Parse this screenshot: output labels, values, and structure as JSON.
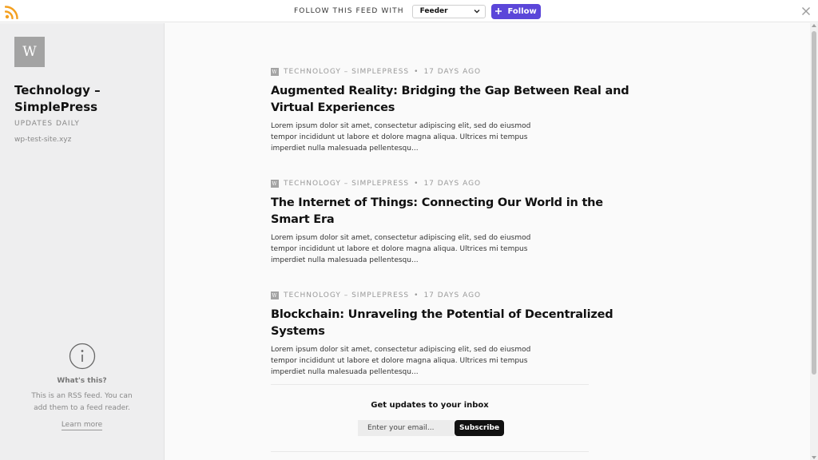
{
  "topbar": {
    "follow_label": "FOLLOW THIS FEED WITH",
    "reader_selected": "Feeder",
    "follow_button": "Follow",
    "accent_color": "#5b46d9",
    "rss_color": "#f4a020"
  },
  "sidebar": {
    "avatar_letter": "W",
    "feed_title": "Technology – SimplePress",
    "frequency": "UPDATES DAILY",
    "site": "wp-test-site.xyz",
    "info": {
      "title": "What's this?",
      "text": "This is an RSS feed. You can add them to a feed reader.",
      "link": "Learn more"
    }
  },
  "articles": [
    {
      "badge": "W",
      "source": "TECHNOLOGY – SIMPLEPRESS",
      "separator": "•",
      "age": "17 DAYS AGO",
      "title": "Augmented Reality: Bridging the Gap Between Real and Virtual Experiences",
      "excerpt": "Lorem ipsum dolor sit amet, consectetur adipiscing elit, sed do eiusmod tempor incididunt ut labore et dolore magna aliqua. Ultrices mi tempus imperdiet nulla malesuada pellentesqu..."
    },
    {
      "badge": "W",
      "source": "TECHNOLOGY – SIMPLEPRESS",
      "separator": "•",
      "age": "17 DAYS AGO",
      "title": "The Internet of Things: Connecting Our World in the Smart Era",
      "excerpt": "Lorem ipsum dolor sit amet, consectetur adipiscing elit, sed do eiusmod tempor incididunt ut labore et dolore magna aliqua. Ultrices mi tempus imperdiet nulla malesuada pellentesqu..."
    },
    {
      "badge": "W",
      "source": "TECHNOLOGY – SIMPLEPRESS",
      "separator": "•",
      "age": "17 DAYS AGO",
      "title": "Blockchain: Unraveling the Potential of Decentralized Systems",
      "excerpt": "Lorem ipsum dolor sit amet, consectetur adipiscing elit, sed do eiusmod tempor incididunt ut labore et dolore magna aliqua. Ultrices mi tempus imperdiet nulla malesuada pellentesqu..."
    }
  ],
  "newsletter": {
    "title": "Get updates to your inbox",
    "email_placeholder": "Enter your email...",
    "subscribe_button": "Subscribe"
  }
}
